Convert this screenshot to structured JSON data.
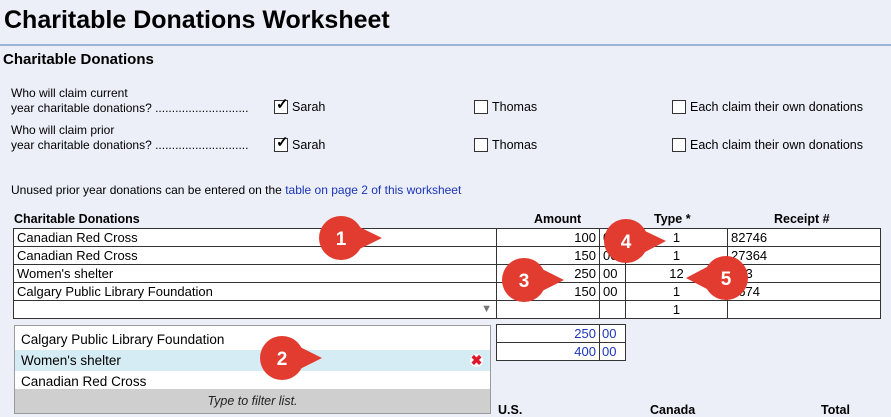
{
  "page": {
    "title": "Charitable Donations Worksheet",
    "section": "Charitable Donations"
  },
  "questions": [
    {
      "label_line1": "Who will claim current",
      "label_line2": "year charitable donations? ............................",
      "options": [
        {
          "label": "Sarah",
          "checked": true
        },
        {
          "label": "Thomas",
          "checked": false
        },
        {
          "label": "Each claim their own donations",
          "checked": false
        }
      ]
    },
    {
      "label_line1": "Who will claim prior",
      "label_line2": "year charitable donations? ............................",
      "options": [
        {
          "label": "Sarah",
          "checked": true
        },
        {
          "label": "Thomas",
          "checked": false
        },
        {
          "label": "Each claim their own donations",
          "checked": false
        }
      ]
    }
  ],
  "note": {
    "text": "Unused prior year donations can be entered on the ",
    "link": "table on page 2 of this worksheet"
  },
  "table": {
    "headers": {
      "name": "Charitable Donations",
      "amount": "Amount",
      "type": "Type *",
      "receipt": "Receipt #"
    },
    "rows": [
      {
        "name": "Canadian Red Cross",
        "amount": "100",
        "cents": "0",
        "type": "1",
        "receipt": "82746"
      },
      {
        "name": "Canadian Red Cross",
        "amount": "150",
        "cents": "00",
        "type": "1",
        "receipt": "27364"
      },
      {
        "name": "Women's shelter",
        "amount": "250",
        "cents": "00",
        "type": "12",
        "receipt": "153"
      },
      {
        "name": "Calgary Public Library Foundation",
        "amount": "150",
        "cents": "00",
        "type": "1",
        "receipt": "2674"
      }
    ],
    "new_row_type": "1",
    "totals": [
      {
        "amount": "250",
        "cents": "00"
      },
      {
        "amount": "400",
        "cents": "00"
      }
    ]
  },
  "dropdown": {
    "items": [
      "Calgary Public Library Foundation",
      "Women's shelter",
      "Canadian Red Cross"
    ],
    "footer": "Type to filter list."
  },
  "bottom_headers": {
    "us": "U.S.",
    "canada": "Canada",
    "total": "Total"
  },
  "markers": [
    "1",
    "2",
    "3",
    "4",
    "5"
  ],
  "colors": {
    "marker": "#e23b30",
    "link": "#1a35b8",
    "selected": "#d5ecf4"
  }
}
